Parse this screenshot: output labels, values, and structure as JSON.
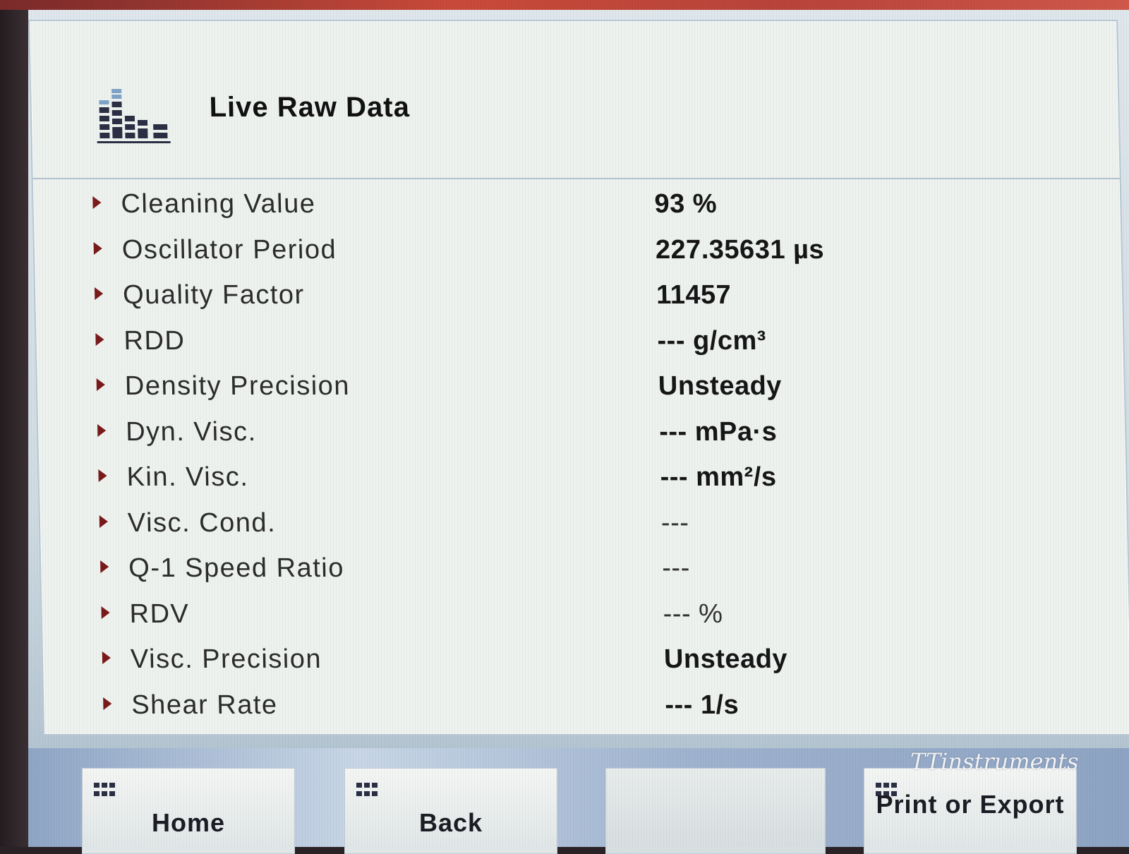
{
  "header": {
    "title": "Live Raw Data",
    "icon": "bar-chart-icon"
  },
  "rows": [
    {
      "label": "Cleaning Value",
      "value": "93 %"
    },
    {
      "label": "Oscillator Period",
      "value": "227.35631 µs"
    },
    {
      "label": "Quality Factor",
      "value": "11457"
    },
    {
      "label": "RDD",
      "value": "--- g/cm³"
    },
    {
      "label": "Density Precision",
      "value": "Unsteady"
    },
    {
      "label": "Dyn. Visc.",
      "value": "--- mPa·s"
    },
    {
      "label": "Kin. Visc.",
      "value": "--- mm²/s"
    },
    {
      "label": "Visc. Cond.",
      "value": "---"
    },
    {
      "label": "Q-1 Speed Ratio",
      "value": "---"
    },
    {
      "label": "RDV",
      "value": "--- %"
    },
    {
      "label": "Visc. Precision",
      "value": "Unsteady"
    },
    {
      "label": "Shear Rate",
      "value": "--- 1/s"
    }
  ],
  "toolbar": {
    "home_label": "Home",
    "back_label": "Back",
    "print_label": "Print or Export"
  },
  "watermark": "TTinstruments",
  "colors": {
    "panel": "#eef2ef",
    "arrow": "#7a1a1a",
    "header_icon": "#2b2f44",
    "toolbar": "#9fb3cf"
  }
}
